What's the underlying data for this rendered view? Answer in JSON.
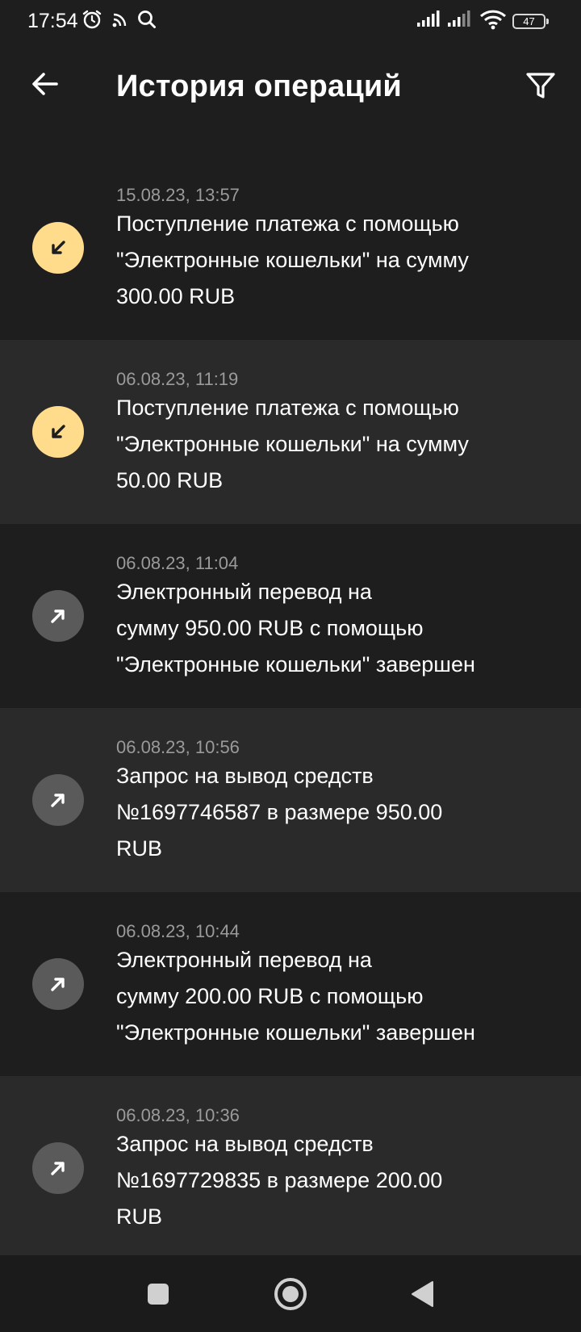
{
  "status_bar": {
    "time": "17:54",
    "icons": [
      "alarm-icon",
      "cast-icon",
      "search-icon",
      "signal-icon",
      "signal-icon",
      "wifi-icon",
      "battery-icon"
    ],
    "battery": "47"
  },
  "app_bar": {
    "title": "История операций",
    "back_icon": "arrow-left-icon",
    "filter_icon": "filter-icon"
  },
  "operations": [
    {
      "date": "15.08.23, 13:57",
      "text": "Поступление платежа с помощью\n\"Электронные кошельки\" на сумму\n300.00 RUB",
      "type": "incoming",
      "icon": "arrow-down-left-icon"
    },
    {
      "date": "06.08.23, 11:19",
      "text": "Поступление платежа с помощью\n\"Электронные кошельки\" на сумму\n50.00 RUB",
      "type": "incoming",
      "icon": "arrow-down-left-icon"
    },
    {
      "date": "06.08.23, 11:04",
      "text": "Электронный перевод на\nсумму 950.00 RUB с помощью\n\"Электронные кошельки\" завершен",
      "type": "outgoing",
      "icon": "arrow-up-right-icon"
    },
    {
      "date": "06.08.23, 10:56",
      "text": "Запрос на вывод средств\n№1697746587 в размере 950.00\nRUB",
      "type": "outgoing",
      "icon": "arrow-up-right-icon"
    },
    {
      "date": "06.08.23, 10:44",
      "text": "Электронный перевод на\nсумму 200.00 RUB с помощью\n\"Электронные кошельки\" завершен",
      "type": "outgoing",
      "icon": "arrow-up-right-icon"
    },
    {
      "date": "06.08.23, 10:36",
      "text": "Запрос на вывод средств\n№1697729835 в размере 200.00\nRUB",
      "type": "outgoing",
      "icon": "arrow-up-right-icon"
    }
  ],
  "nav_bar": {
    "icons": [
      "recents-square-icon",
      "home-circle-icon",
      "back-triangle-icon"
    ]
  },
  "colors": {
    "background": "#1e1e1e",
    "row_alt": "#2a2a2a",
    "incoming_accent": "#ffdc8c",
    "outgoing_accent": "#5a5a5a"
  }
}
